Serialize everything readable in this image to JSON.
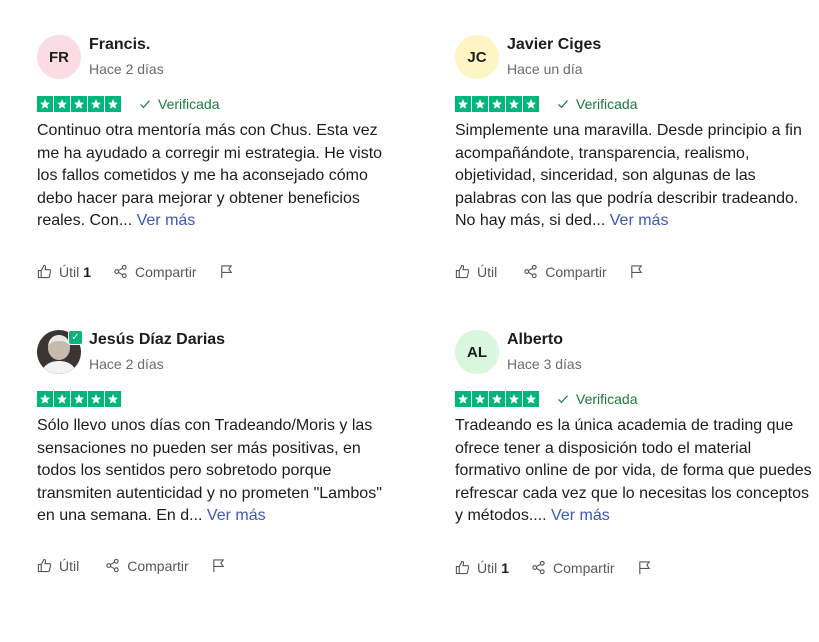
{
  "colors": {
    "star": "#00b67a",
    "verified": "#1a7a3e",
    "link": "#3c57bc"
  },
  "reviews": [
    {
      "initials": "FR",
      "avatar_bg": "#fbdbe4",
      "name": "Francis.",
      "date": "Hace 2 días",
      "verified": "Verificada",
      "text": "Continuo otra mentoría más con Chus. Esta vez me ha ayudado a corregir mi estrategia. He visto los fallos cometidos y me ha aconsejado cómo debo hacer para mejorar y obtener beneficios reales. Con...",
      "more": "Ver más",
      "useful": "Útil",
      "useful_count": "1",
      "share": "Compartir"
    },
    {
      "initials": "JC",
      "avatar_bg": "#fdf5c3",
      "name": "Javier Ciges",
      "date": "Hace un día",
      "verified": "Verificada",
      "text": "Simplemente una maravilla. Desde principio a fin acompañándote, transparencia, realismo, objetividad, sinceridad, son algunas de las palabras con las que podría describir tradeando. No hay más, si ded...",
      "more": "Ver más",
      "useful": "Útil",
      "useful_count": "",
      "share": "Compartir"
    },
    {
      "initials": "",
      "avatar_bg": "",
      "name": "Jesús Díaz Darias",
      "date": "Hace 2 días",
      "verified": "",
      "text": "Sólo llevo unos días con Tradeando/Moris y las sensaciones no pueden ser más positivas, en todos los sentidos pero sobretodo porque transmiten autenticidad y no prometen \"Lambos\" en una semana. En d...",
      "more": "Ver más",
      "useful": "Útil",
      "useful_count": "",
      "share": "Compartir"
    },
    {
      "initials": "AL",
      "avatar_bg": "#d9f7dc",
      "name": "Alberto",
      "date": "Hace 3 días",
      "verified": "Verificada",
      "text": "Tradeando es la única academia de trading que ofrece tener a disposición todo el material formativo online de por vida, de forma que puedes refrescar cada vez que lo necesitas los conceptos y métodos....",
      "more": "Ver más",
      "useful": "Útil",
      "useful_count": "1",
      "share": "Compartir"
    }
  ]
}
